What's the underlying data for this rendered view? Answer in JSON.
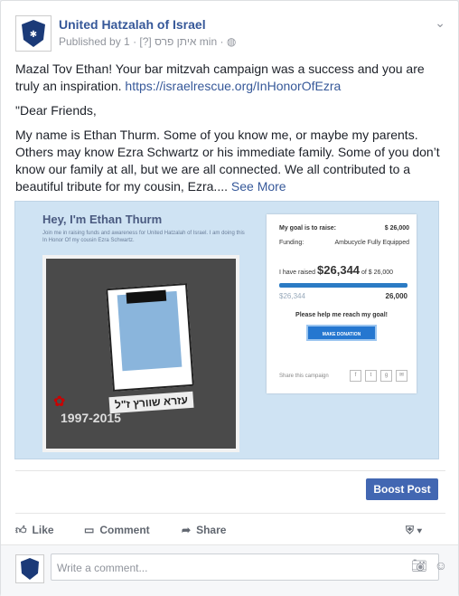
{
  "post": {
    "page_name": "United Hatzalah of Israel",
    "meta": "Published by איתן פרס [?] · 1 min · ",
    "line1": "Mazal Tov Ethan! Your bar mitzvah campaign was a success and you are truly an inspiration. ",
    "link": "https://israelrescue.org/InHonorOfEzra",
    "line2": "\"Dear Friends,",
    "line3": "My name is Ethan Thurm. Some of you know me, or maybe my parents. Others may know Ezra Schwartz or his immediate family. Some of you don’t know our family at all, but we are all connected. We all contributed to a beautiful tribute for my cousin, Ezra.... ",
    "see_more": "See More"
  },
  "embed": {
    "hey": "Hey, I'm Ethan Thurm",
    "intro": "Join me in raising funds and awareness for United Hatzalah of Israel. I am doing this In Honor Of my cousin Ezra Schwartz.",
    "caption": "עזרא שוורץ ז\"ל",
    "years": "1997-2015",
    "goal_label": "My goal is to raise:",
    "goal_value": "$ 26,000",
    "funding_label": "Funding:",
    "funding_value": "Ambucycle Fully Equipped",
    "raised_prefix": "I have raised ",
    "raised_value": "$26,344",
    "raised_suffix": " of $ 26,000",
    "progress_fraction": 1.0,
    "bar_left": "$26,344",
    "bar_right": "26,000",
    "help": "Please help me reach my goal!",
    "donate": "MAKE DONATION",
    "share": "Share this campaign"
  },
  "actions": {
    "boost": "Boost Post",
    "like": "Like",
    "comment": "Comment",
    "share": "Share"
  },
  "comment": {
    "placeholder": "Write a comment..."
  }
}
